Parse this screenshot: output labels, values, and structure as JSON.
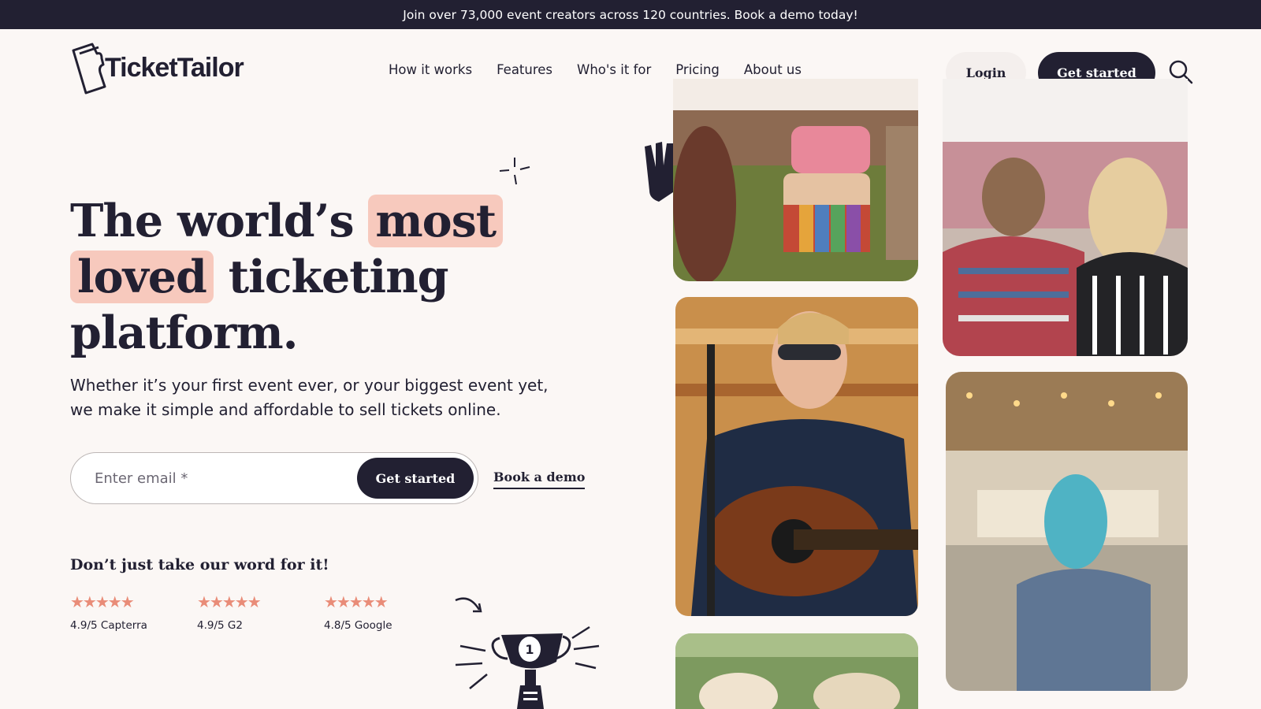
{
  "banner": {
    "text": "Join over 73,000 event creators across 120 countries. Book a demo today!"
  },
  "header": {
    "logo_text": "TicketTailor",
    "nav": [
      "How it works",
      "Features",
      "Who's it for",
      "Pricing",
      "About us"
    ],
    "login_label": "Login",
    "cta_label": "Get started"
  },
  "hero": {
    "title_part1": "The world’s ",
    "title_highlight1": "most",
    "title_highlight2": "loved",
    "title_part2": " ticketing platform.",
    "subtitle": "Whether it’s your first event ever, or your biggest event yet, we make it simple and affordable to sell tickets online.",
    "email_placeholder": "Enter email *",
    "signup_label": "Get started",
    "demo_label": "Book a demo"
  },
  "social_proof": {
    "title": "Don’t just take our word for it!",
    "ratings": [
      {
        "stars": "★★★★★",
        "label": "4.9/5 Capterra"
      },
      {
        "stars": "★★★★★",
        "label": "4.9/5 G2"
      },
      {
        "stars": "★★★★★",
        "label": "4.8/5 Google"
      }
    ]
  },
  "colors": {
    "dark": "#222032",
    "highlight": "#f7c9bd",
    "star": "#e98c78",
    "background": "#fbf7f5"
  }
}
